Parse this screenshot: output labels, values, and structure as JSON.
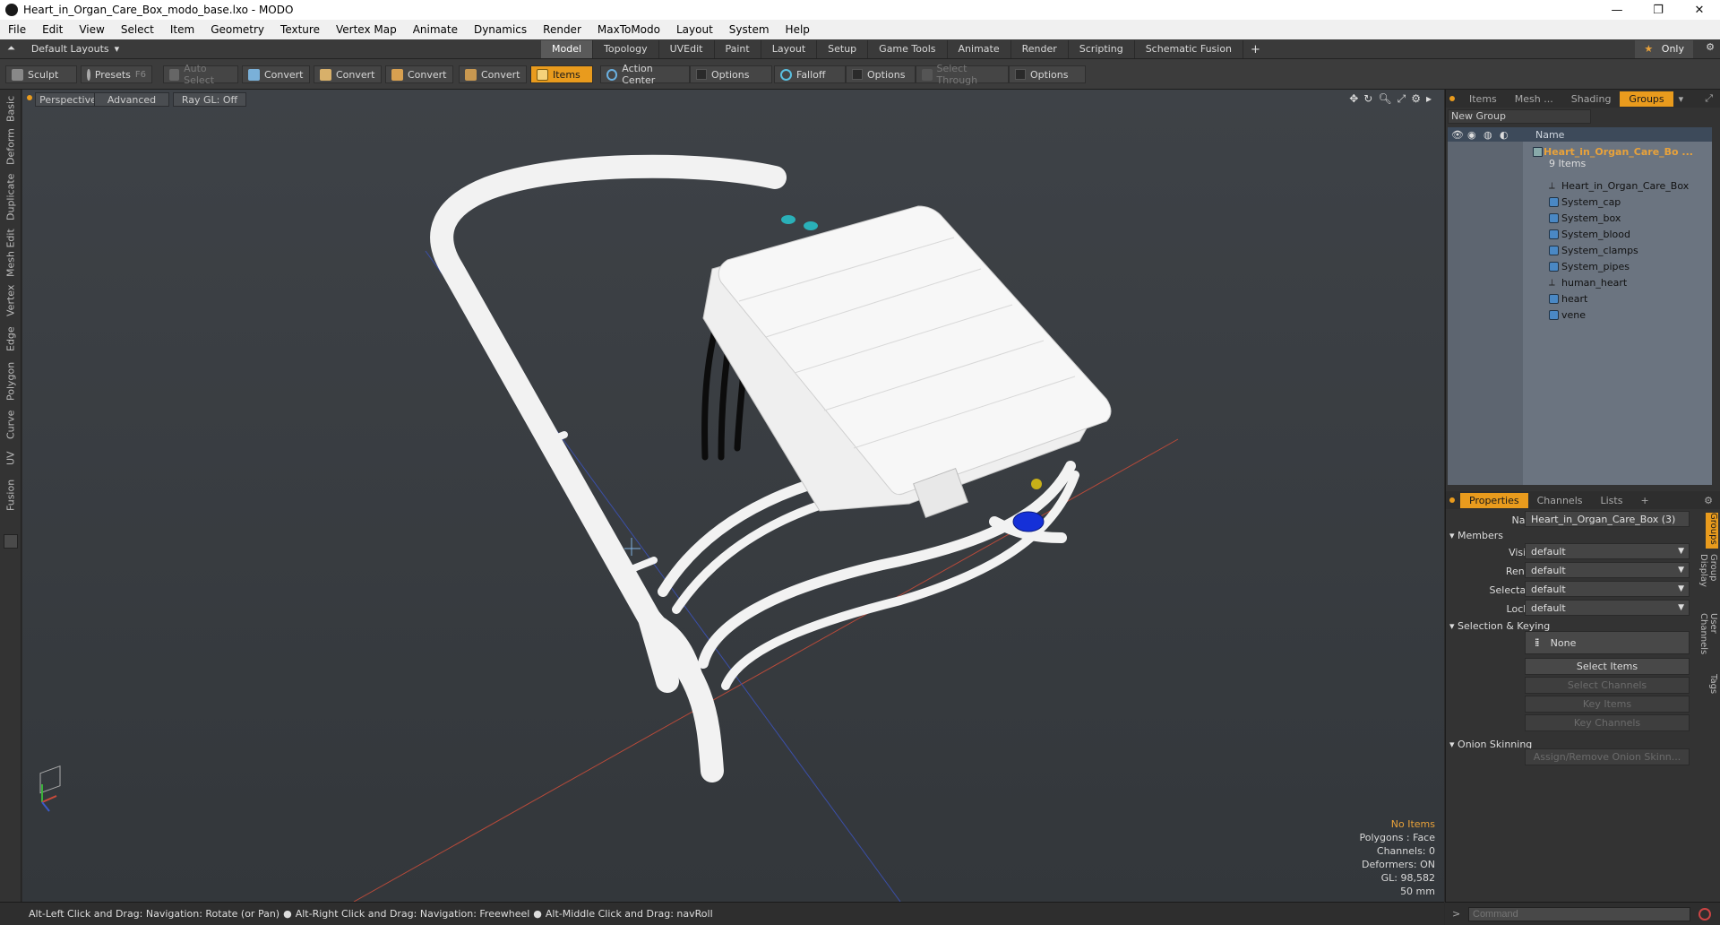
{
  "window": {
    "title": "Heart_in_Organ_Care_Box_modo_base.lxo - MODO",
    "minimize": "—",
    "maximize": "❐",
    "close": "✕"
  },
  "menu": [
    "File",
    "Edit",
    "View",
    "Select",
    "Item",
    "Geometry",
    "Texture",
    "Vertex Map",
    "Animate",
    "Dynamics",
    "Render",
    "MaxToModo",
    "Layout",
    "System",
    "Help"
  ],
  "layout": {
    "dropdown": "Default Layouts",
    "tabs": [
      "Model",
      "Topology",
      "UVEdit",
      "Paint",
      "Layout",
      "Setup",
      "Game Tools",
      "Animate",
      "Render",
      "Scripting",
      "Schematic Fusion"
    ],
    "active_tab": "Model",
    "add": "+",
    "only": "Only"
  },
  "toolbar": {
    "sculpt": "Sculpt",
    "presets": "Presets",
    "presets_key": "F6",
    "auto_select": "Auto Select",
    "convert1": "Convert",
    "convert2": "Convert",
    "convert3": "Convert",
    "convert4": "Convert",
    "items": "Items",
    "action_center": "Action Center",
    "options1": "Options",
    "falloff": "Falloff",
    "options2": "Options",
    "select_through": "Select Through",
    "options3": "Options"
  },
  "left_tabs": [
    "Basic",
    "Deform",
    "Duplicate",
    "Mesh Edit",
    "Vertex",
    "Edge",
    "Polygon",
    "Curve",
    "UV",
    "Fusion"
  ],
  "viewport": {
    "view": "Perspective",
    "shading": "Advanced",
    "raygl": "Ray GL: Off",
    "info": {
      "no_items": "No Items",
      "polygons": "Polygons : Face",
      "channels": "Channels: 0",
      "deformers": "Deformers: ON",
      "gl": "GL: 98,582",
      "scale": "50 mm"
    }
  },
  "groups_panel": {
    "tabs": [
      "Items",
      "Mesh ...",
      "Shading",
      "Groups"
    ],
    "active_tab": "Groups",
    "new_group": "New Group",
    "col_name": "Name",
    "root": "Heart_in_Organ_Care_Bo ...",
    "root_count": "9 Items",
    "items": [
      {
        "name": "Heart_in_Organ_Care_Box",
        "icon": "locator-icon"
      },
      {
        "name": "System_cap",
        "icon": "mesh-icon"
      },
      {
        "name": "System_box",
        "icon": "mesh-icon"
      },
      {
        "name": "System_blood",
        "icon": "mesh-icon"
      },
      {
        "name": "System_clamps",
        "icon": "mesh-icon"
      },
      {
        "name": "System_pipes",
        "icon": "mesh-icon"
      },
      {
        "name": "human_heart",
        "icon": "locator-icon"
      },
      {
        "name": "heart",
        "icon": "mesh-icon"
      },
      {
        "name": "vene",
        "icon": "mesh-icon"
      }
    ]
  },
  "properties_panel": {
    "tabs": [
      "Properties",
      "Channels",
      "Lists"
    ],
    "active_tab": "Properties",
    "add": "+",
    "name_label": "Name",
    "name_value": "Heart_in_Organ_Care_Box (3)",
    "members": "Members",
    "visible_label": "Visible",
    "visible_value": "default",
    "render_label": "Render",
    "render_value": "default",
    "selectable_label": "Selectable",
    "selectable_value": "default",
    "locked_label": "Locked",
    "locked_value": "default",
    "selection_keying": "Selection & Keying",
    "none": "None",
    "select_items": "Select Items",
    "select_channels": "Select Channels",
    "key_items": "Key Items",
    "key_channels": "Key Channels",
    "onion_skinning": "Onion Skinning",
    "assign_onion": "Assign/Remove Onion Skinn...",
    "side_tabs": [
      "Groups",
      "Group Display",
      "User Channels",
      "Tags"
    ]
  },
  "status": {
    "hint1": "Alt-Left Click and Drag: Navigation: Rotate (or Pan)",
    "hint2": "Alt-Right Click and Drag: Navigation: Freewheel",
    "hint3": "Alt-Middle Click and Drag: navRoll",
    "command_placeholder": "Command"
  },
  "colors": {
    "accent": "#e99b1d",
    "viewport_bg": "#3a3e42",
    "model": "#f2f2f2"
  }
}
